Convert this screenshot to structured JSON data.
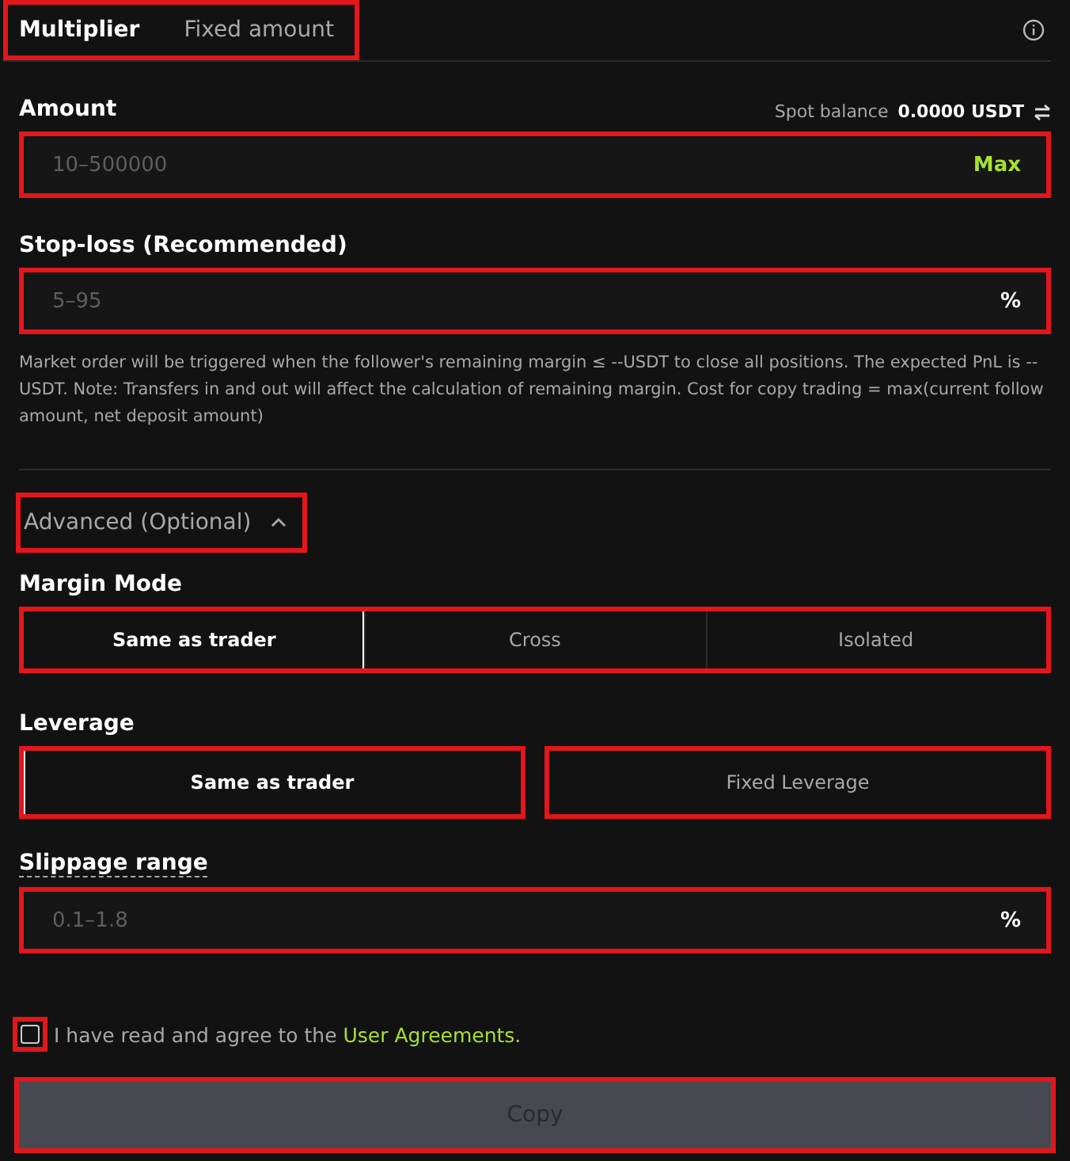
{
  "tabs": [
    {
      "label": "Multiplier",
      "selected": true
    },
    {
      "label": "Fixed amount",
      "selected": false
    }
  ],
  "amount": {
    "label": "Amount",
    "balance_label": "Spot balance",
    "balance_value": "0.0000 USDT",
    "placeholder": "10–500000",
    "max_label": "Max"
  },
  "stop_loss": {
    "label": "Stop-loss (Recommended)",
    "placeholder": "5–95",
    "unit": "%",
    "note": "Market order will be triggered when the follower's remaining margin ≤ --USDT to close all positions. The expected PnL is -- USDT. Note: Transfers in and out will affect the calculation of remaining margin. Cost for copy trading = max(current follow amount, net deposit amount)"
  },
  "advanced": {
    "label": "Advanced (Optional)",
    "expanded": true
  },
  "margin_mode": {
    "label": "Margin Mode",
    "options": [
      {
        "label": "Same as trader",
        "selected": true
      },
      {
        "label": "Cross",
        "selected": false
      },
      {
        "label": "Isolated",
        "selected": false
      }
    ]
  },
  "leverage": {
    "label": "Leverage",
    "options": [
      {
        "label": "Same as trader",
        "selected": true
      },
      {
        "label": "Fixed Leverage",
        "selected": false
      }
    ]
  },
  "slippage": {
    "label": "Slippage range",
    "placeholder": "0.1–1.8",
    "unit": "%"
  },
  "agreement": {
    "checked": false,
    "text": "I have read and agree to the",
    "link": "User Agreements."
  },
  "submit": {
    "label": "Copy",
    "disabled": true
  }
}
